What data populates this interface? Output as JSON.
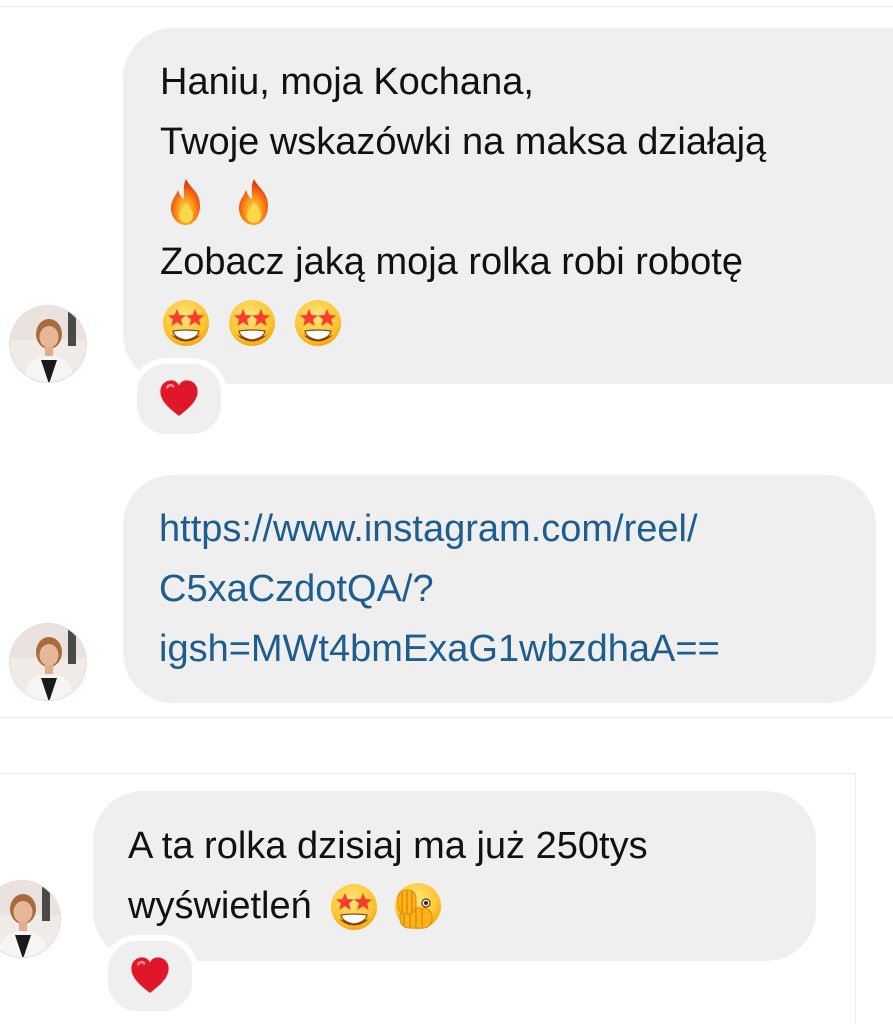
{
  "messages": [
    {
      "lines": [
        "Haniu, moja Kochana,",
        "Twoje wskazówki na maksa działają"
      ],
      "emoji_row_1": [
        "fire",
        "fire"
      ],
      "line3": "Zobacz jaką moja rolka robi robotę",
      "emoji_row_2": [
        "star-struck",
        "star-struck",
        "star-struck"
      ],
      "reaction": "red-heart"
    },
    {
      "link_lines": [
        "https://www.instagram.com/reel/",
        "C5xaCzdotQA/?",
        "igsh=MWt4bmExaG1wbzdhaA=="
      ]
    },
    {
      "line1": "A ta rolka dzisiaj ma już 250tys",
      "line2": "wyświetleń",
      "trailing_emojis": [
        "star-struck",
        "face-with-hand-over-mouth-peeking"
      ],
      "reaction": "red-heart"
    }
  ],
  "colors": {
    "bubble": "#efefef",
    "link": "#1d5d8f",
    "text": "#111111",
    "heart": "#e0162b"
  }
}
